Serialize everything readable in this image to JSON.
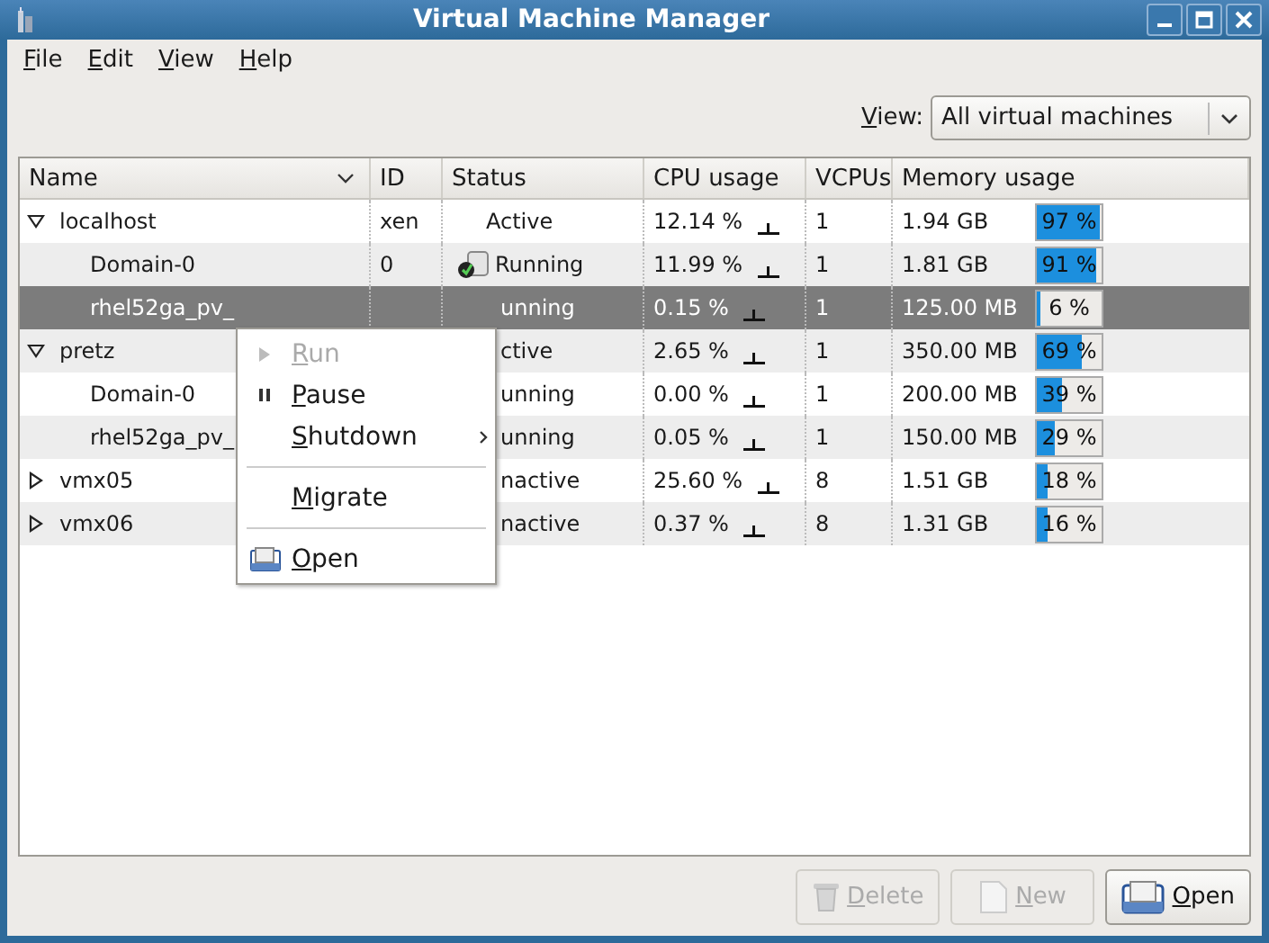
{
  "window": {
    "title": "Virtual Machine Manager"
  },
  "menu_bar": [
    "File",
    "Edit",
    "View",
    "Help"
  ],
  "view_filter": {
    "label": "View:",
    "value": "All virtual machines"
  },
  "table": {
    "columns": [
      "Name",
      "ID",
      "Status",
      "CPU usage",
      "VCPUs",
      "Memory usage"
    ],
    "rows": [
      {
        "kind": "host",
        "name": "localhost",
        "id": "xen",
        "status": "Active",
        "status_icon": false,
        "cpu": "12.14 %",
        "vcpus": "1",
        "memory": "1.94 GB",
        "mem_label": "97 %",
        "level": 0.97,
        "expanded": true,
        "selected": false,
        "children": [
          {
            "kind": "vm",
            "name": "Domain-0",
            "id": "0",
            "status": "Running",
            "status_icon": true,
            "cpu": "11.99 %",
            "vcpus": "1",
            "memory": "1.81 GB",
            "mem_label": "91 %",
            "level": 0.91,
            "selected": false
          },
          {
            "kind": "vm",
            "name": "rhel52ga_pv_",
            "status": "unning",
            "status_icon": false,
            "cpu": "0.15 %",
            "vcpus": "1",
            "memory": "125.00 MB",
            "mem_label": "6 %",
            "level": 0.06,
            "selected": true
          }
        ]
      },
      {
        "kind": "host",
        "name": "pretz",
        "status": "ctive",
        "status_icon": false,
        "cpu": "2.65 %",
        "vcpus": "1",
        "memory": "350.00 MB",
        "mem_label": "69 %",
        "level": 0.69,
        "expanded": true,
        "selected": false,
        "children": [
          {
            "kind": "vm",
            "name": "Domain-0",
            "status": "unning",
            "status_icon": false,
            "cpu": "0.00 %",
            "vcpus": "1",
            "memory": "200.00 MB",
            "mem_label": "39 %",
            "level": 0.39,
            "selected": false
          },
          {
            "kind": "vm",
            "name": "rhel52ga_pv_",
            "status": "unning",
            "status_icon": false,
            "cpu": "0.05 %",
            "vcpus": "1",
            "memory": "150.00 MB",
            "mem_label": "29 %",
            "level": 0.29,
            "selected": false
          }
        ]
      },
      {
        "kind": "host",
        "name": "vmx05",
        "status": "nactive",
        "status_icon": false,
        "cpu": "25.60 %",
        "vcpus": "8",
        "memory": "1.51 GB",
        "mem_label": "18 %",
        "level": 0.18,
        "expanded": false,
        "selected": false
      },
      {
        "kind": "host",
        "name": "vmx06",
        "status": "nactive",
        "status_icon": false,
        "cpu": "0.37 %",
        "vcpus": "8",
        "memory": "1.31 GB",
        "mem_label": "16 %",
        "level": 0.16,
        "expanded": false,
        "selected": false
      }
    ]
  },
  "context_menu": [
    {
      "kind": "play",
      "label": "Run",
      "disabled": true
    },
    {
      "kind": "pause",
      "label": "Pause",
      "disabled": false
    },
    {
      "kind": "submenu",
      "label": "Shutdown",
      "disabled": false
    },
    {
      "kind": "separator"
    },
    {
      "kind": "plain",
      "label": "Migrate",
      "disabled": false
    },
    {
      "kind": "separator"
    },
    {
      "kind": "open",
      "label": "Open",
      "disabled": false
    }
  ],
  "buttons": [
    {
      "kind": "trash",
      "label": "Delete",
      "disabled": true
    },
    {
      "kind": "new",
      "label": "New",
      "disabled": true
    },
    {
      "kind": "open",
      "label": "Open",
      "disabled": false
    }
  ]
}
